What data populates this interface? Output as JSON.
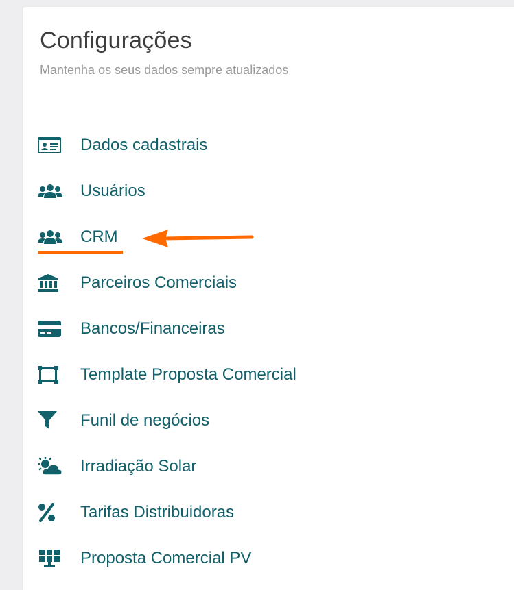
{
  "header": {
    "title": "Configurações",
    "subtitle": "Mantenha os seus dados sempre atualizados"
  },
  "menu": {
    "items": [
      {
        "label": "Dados cadastrais",
        "icon": "id-card-icon"
      },
      {
        "label": "Usuários",
        "icon": "users-icon"
      },
      {
        "label": "CRM",
        "icon": "users-icon"
      },
      {
        "label": "Parceiros Comerciais",
        "icon": "bank-icon"
      },
      {
        "label": "Bancos/Financeiras",
        "icon": "credit-card-icon"
      },
      {
        "label": "Template Proposta Comercial",
        "icon": "crop-frame-icon"
      },
      {
        "label": "Funil de negócios",
        "icon": "funnel-icon"
      },
      {
        "label": "Irradiação Solar",
        "icon": "sun-cloud-icon"
      },
      {
        "label": "Tarifas Distribuidoras",
        "icon": "percent-icon"
      },
      {
        "label": "Proposta Comercial PV",
        "icon": "solar-panel-icon"
      }
    ]
  },
  "colors": {
    "accent_teal": "#11606a",
    "annotation_orange": "#ff6a00",
    "title": "#3d3d3d",
    "subtitle": "#9a9a9a"
  }
}
